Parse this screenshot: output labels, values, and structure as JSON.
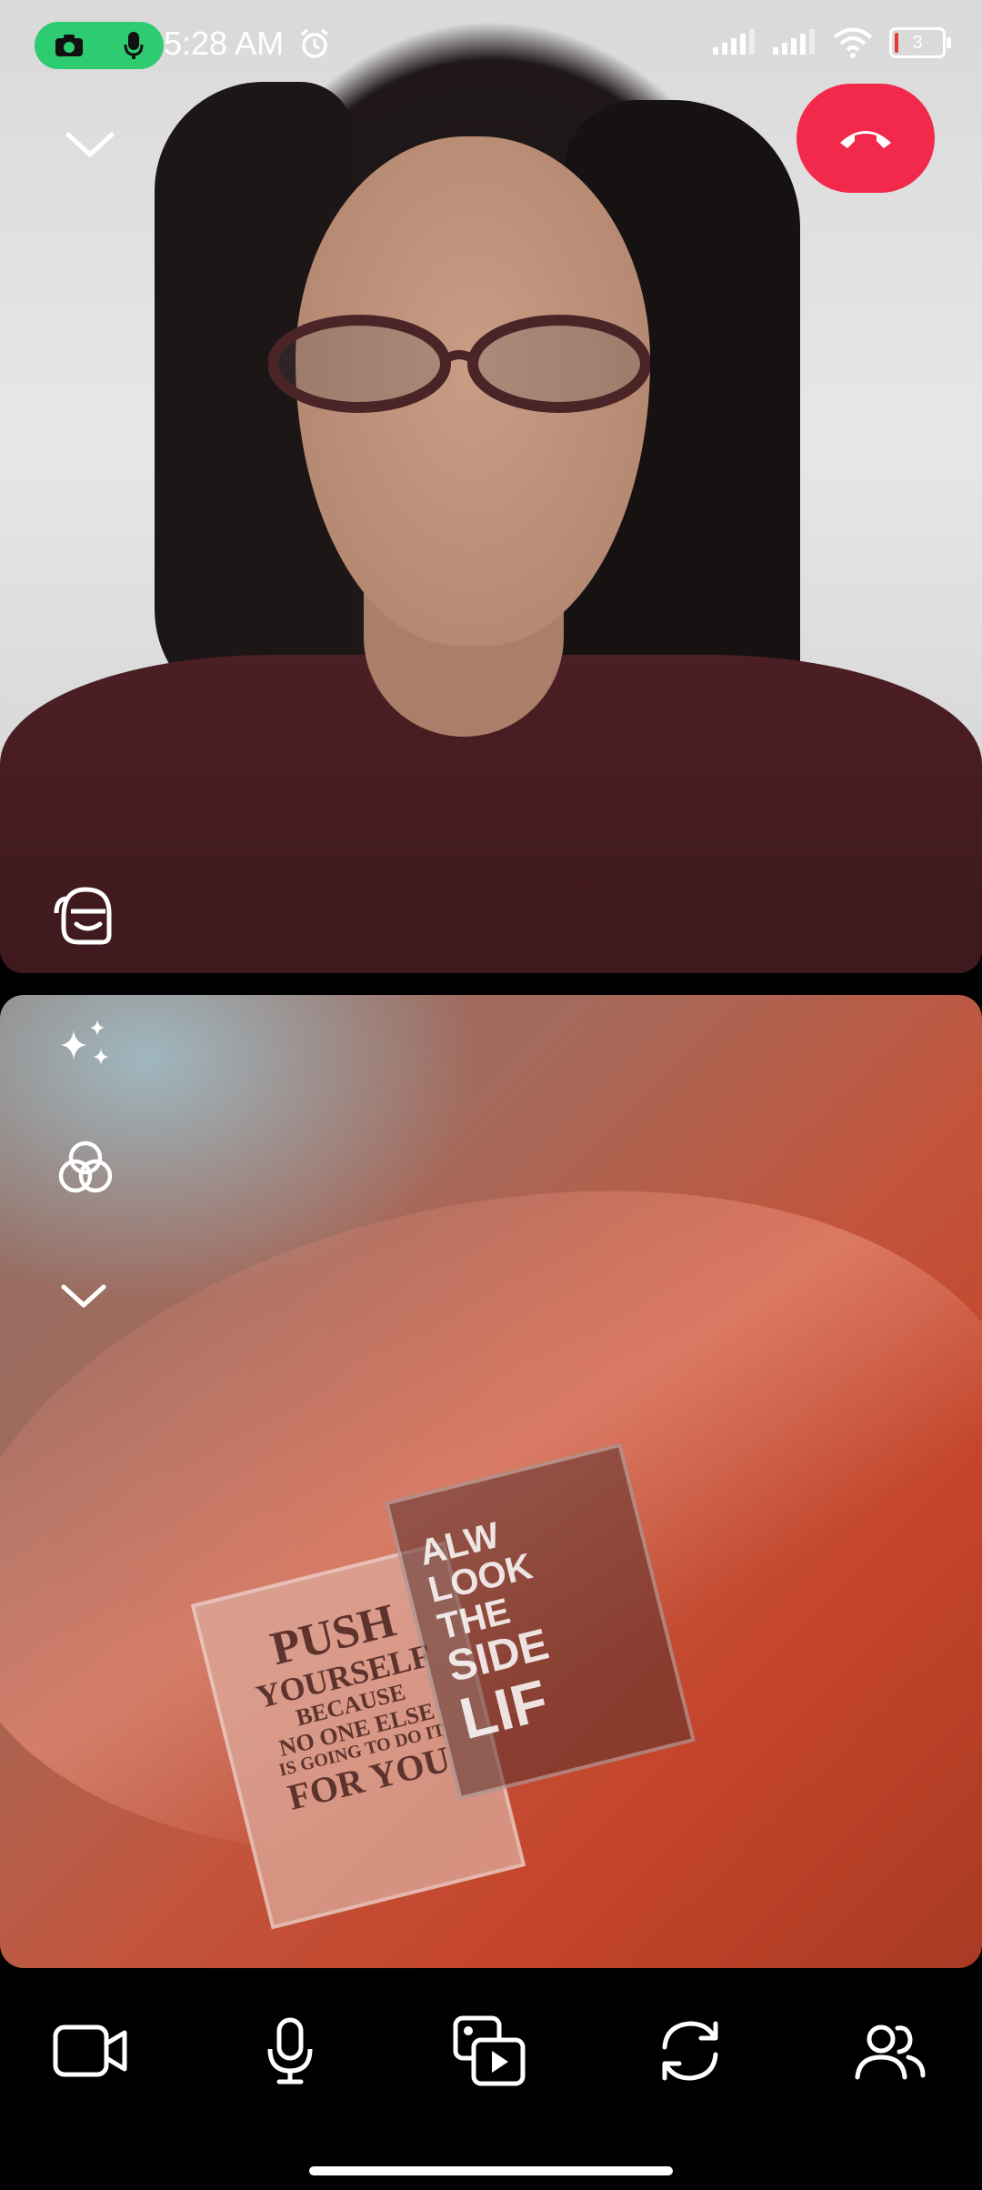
{
  "status_bar": {
    "time": "5:28 AM",
    "battery_level": "3"
  },
  "icons": {
    "recording": [
      "camera-icon",
      "microphone-icon"
    ],
    "top_left": "chevron-down-icon",
    "end_call": "hang-up-icon",
    "remote_overlay": "bitmoji-icon",
    "local_overlay": [
      "sparkle-icon",
      "lens-filter-icon",
      "chevron-down-icon"
    ],
    "bottom_bar": [
      "video-camera-icon",
      "microphone-icon",
      "share-media-icon",
      "flip-camera-icon",
      "participants-icon"
    ]
  },
  "colors": {
    "end_call": "#f2294a",
    "recording_pill": "#2ecc71"
  },
  "local_video": {
    "poster_left": [
      "PUSH",
      "YOURSELF",
      "BECAUSE",
      "NO ONE ELSE",
      "IS GOING TO DO IT",
      "FOR YOU"
    ],
    "poster_right": [
      "ALW",
      "LOOK",
      "THE",
      "SIDE",
      "LIF"
    ]
  }
}
